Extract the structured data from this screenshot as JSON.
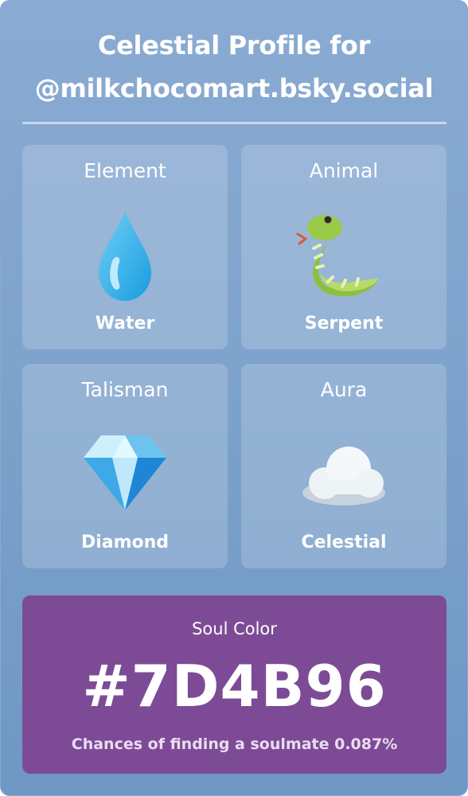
{
  "profile": {
    "title_line1": "Celestial Profile for",
    "title_line2": "@milkchocomart.bsky.social"
  },
  "tiles": [
    {
      "label": "Element",
      "value": "Water",
      "icon": "water-drop-icon"
    },
    {
      "label": "Animal",
      "value": "Serpent",
      "icon": "snake-icon"
    },
    {
      "label": "Talisman",
      "value": "Diamond",
      "icon": "gem-icon"
    },
    {
      "label": "Aura",
      "value": "Celestial",
      "icon": "cloud-icon"
    }
  ],
  "soul_color": {
    "label": "Soul Color",
    "hex": "#7D4B96",
    "note": "Chances of finding a soulmate 0.087%"
  },
  "colors": {
    "background_top": "#8aabd3",
    "background_bottom": "#6f97c4",
    "soul_panel": "#7d4b96"
  }
}
